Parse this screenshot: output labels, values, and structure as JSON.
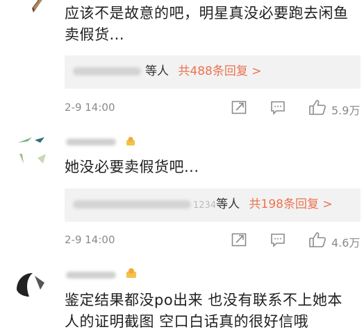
{
  "comments": [
    {
      "text_lines": [
        "应该不是故意的吧，明星真没必要跑去闲鱼",
        "卖假货..."
      ],
      "reply_suffix": "等人",
      "reply_link": "共488条回复 >",
      "date": "2-9 14:00",
      "likes": "5.9万"
    },
    {
      "text_lines": [
        "她没必要卖假货吧..."
      ],
      "reply_prefix": "1234",
      "reply_suffix": "等人",
      "reply_link": "共198条回复 >",
      "date": "2-9 14:00",
      "likes": "4.6万"
    },
    {
      "text_lines": [
        "鉴定结果都没po出来 也没有联系不上她本",
        "人的证明截图 空口白话真的很好信哦"
      ]
    }
  ],
  "icons": [
    "share-icon",
    "comment-icon",
    "like-icon",
    "badge-icon"
  ],
  "colors": {
    "reply_link": "#eb7350",
    "meta": "#8a8a8a",
    "reply_bg": "#f2f2f2"
  }
}
